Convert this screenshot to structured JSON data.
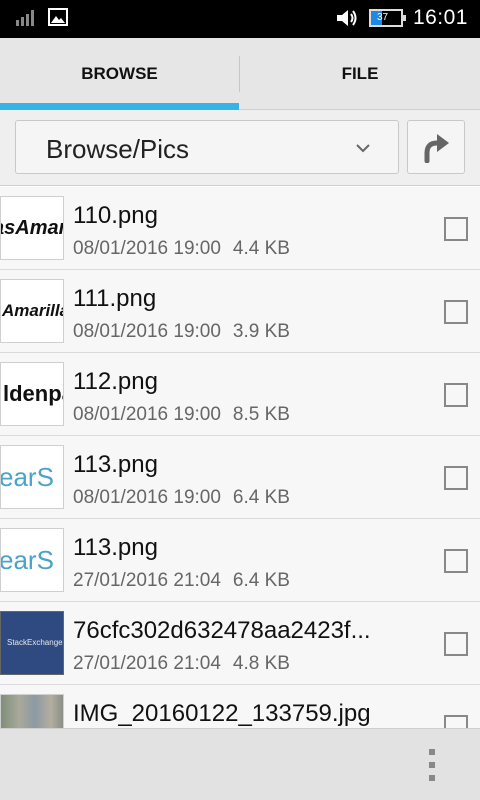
{
  "status_bar": {
    "time": "16:01",
    "battery_level": "37",
    "icons": [
      "signal-icon",
      "image-notification-icon",
      "volume-icon",
      "battery-icon"
    ]
  },
  "tabs": [
    {
      "label": "BROWSE",
      "selected": true
    },
    {
      "label": "FILE",
      "selected": false
    }
  ],
  "path": {
    "current": "Browse/Pics",
    "up_icon": "up-arrow-icon"
  },
  "files": [
    {
      "name": "110.png",
      "date": "08/01/2016 19:00",
      "size": "4.4 KB",
      "thumb_text": "asAmar"
    },
    {
      "name": "111.png",
      "date": "08/01/2016 19:00",
      "size": "3.9 KB",
      "thumb_text": "Amarillas"
    },
    {
      "name": "112.png",
      "date": "08/01/2016 19:00",
      "size": "8.5 KB",
      "thumb_text": "ldenpa"
    },
    {
      "name": "113.png",
      "date": "08/01/2016 19:00",
      "size": "6.4 KB",
      "thumb_text": "earS"
    },
    {
      "name": "113.png",
      "date": "27/01/2016 21:04",
      "size": "6.4 KB",
      "thumb_text": "earS"
    },
    {
      "name": "76cfc302d632478aa2423f...",
      "date": "27/01/2016 21:04",
      "size": "4.8 KB",
      "thumb_text": "StackExchange"
    },
    {
      "name": "IMG_20160122_133759.jpg",
      "date": "",
      "size": "",
      "thumb_text": ""
    }
  ],
  "colors": {
    "accent": "#33b5e5",
    "status_bar": "#000000"
  }
}
